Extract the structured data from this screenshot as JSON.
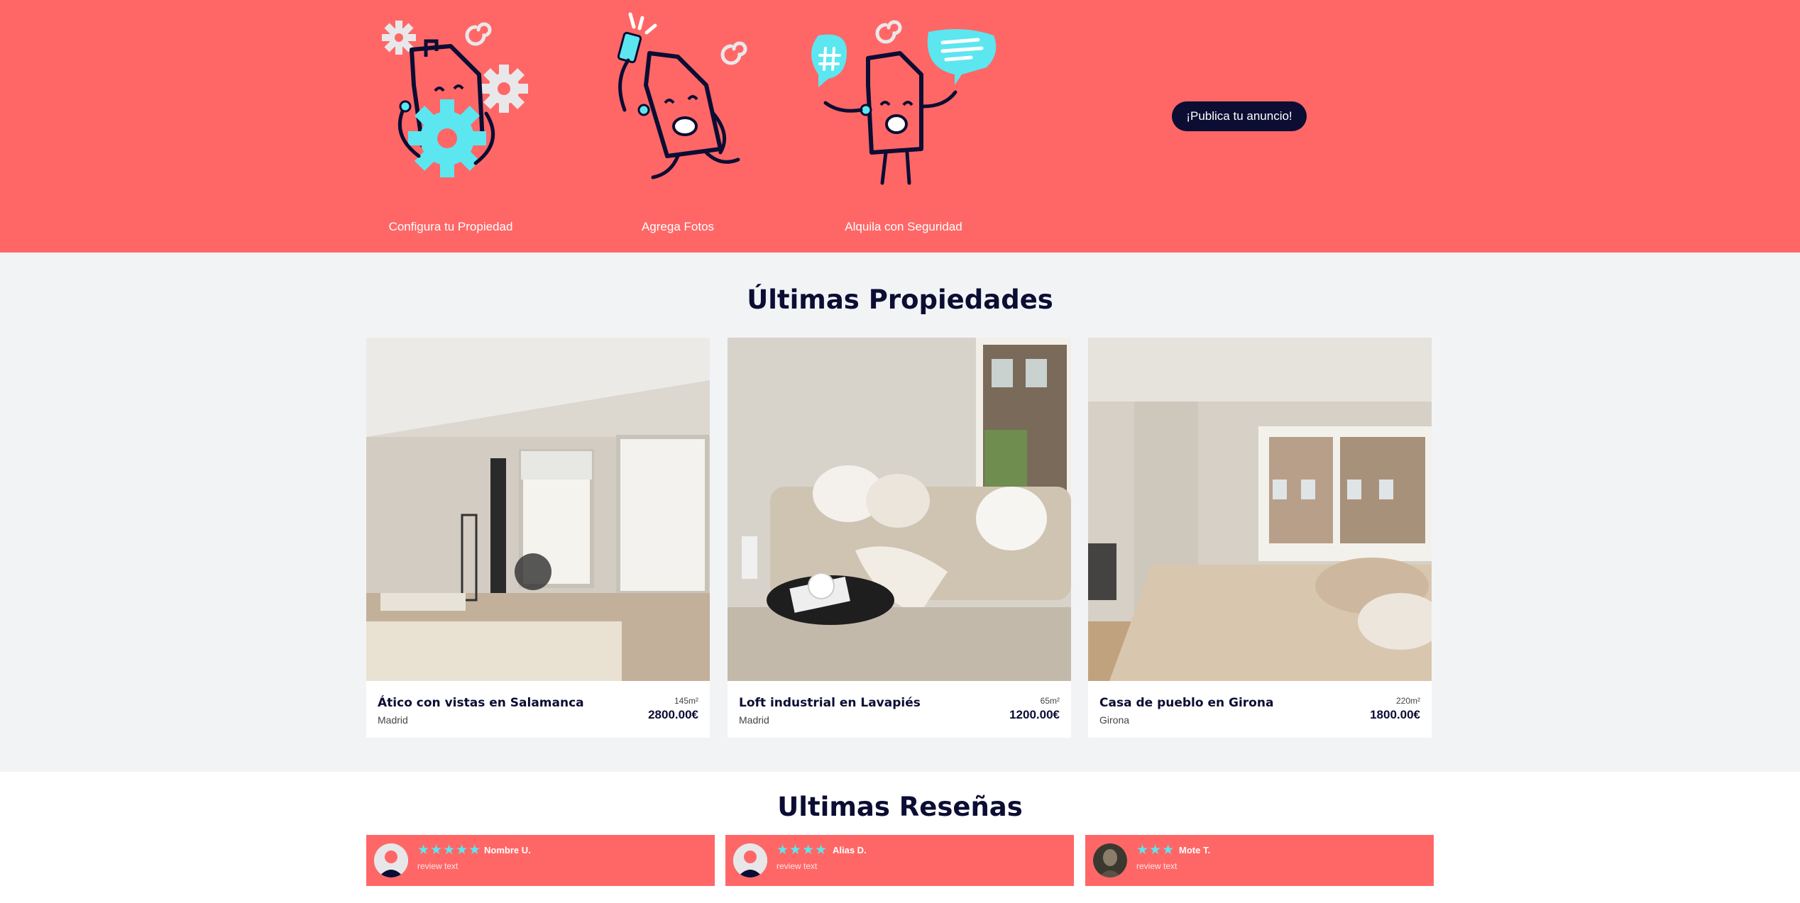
{
  "hero": {
    "steps": [
      {
        "caption": "Configura tu Propiedad",
        "icon": "house-with-gears-icon"
      },
      {
        "caption": "Agrega Fotos",
        "icon": "house-taking-selfie-icon"
      },
      {
        "caption": "Alquila con Seguridad",
        "icon": "house-chatting-icon"
      }
    ],
    "publish_label": "¡Publica tu anuncio!",
    "colors": {
      "background": "#ff6767",
      "accent": "#5ce6f0",
      "ink": "#0b0d33"
    }
  },
  "properties": {
    "title": "Últimas Propiedades",
    "items": [
      {
        "name": "Ático con vistas en Salamanca",
        "city": "Madrid",
        "area": "145m²",
        "price": "2800.00€"
      },
      {
        "name": "Loft industrial en Lavapiés",
        "city": "Madrid",
        "area": "65m²",
        "price": "1200.00€"
      },
      {
        "name": "Casa de pueblo en Girona",
        "city": "Girona",
        "area": "220m²",
        "price": "1800.00€"
      }
    ]
  },
  "reviews": {
    "title": "Ultimas Reseñas",
    "items": [
      {
        "stars": "★★★★★",
        "rating": 5,
        "name": "Nombre U.",
        "text": "review text"
      },
      {
        "stars": "★★★★",
        "rating": 4,
        "name": "Alias D.",
        "text": "review text"
      },
      {
        "stars": "★★★",
        "rating": 3,
        "name": "Mote T.",
        "text": "review text"
      }
    ]
  }
}
